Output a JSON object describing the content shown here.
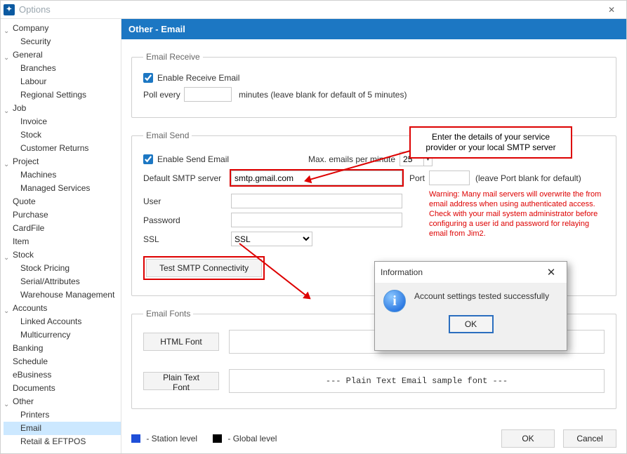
{
  "window": {
    "title": "Options"
  },
  "sidebar": {
    "items": [
      {
        "label": "Company",
        "expandable": true,
        "children": [
          {
            "label": "Security"
          }
        ]
      },
      {
        "label": "General",
        "expandable": true,
        "children": [
          {
            "label": "Branches"
          },
          {
            "label": "Labour"
          },
          {
            "label": "Regional Settings"
          }
        ]
      },
      {
        "label": "Job",
        "expandable": true,
        "children": [
          {
            "label": "Invoice"
          },
          {
            "label": "Stock"
          },
          {
            "label": "Customer Returns"
          }
        ]
      },
      {
        "label": "Project",
        "expandable": true,
        "children": [
          {
            "label": "Machines"
          },
          {
            "label": "Managed Services"
          }
        ]
      },
      {
        "label": "Quote",
        "expandable": false
      },
      {
        "label": "Purchase",
        "expandable": false
      },
      {
        "label": "CardFile",
        "expandable": false
      },
      {
        "label": "Item",
        "expandable": false
      },
      {
        "label": "Stock",
        "expandable": true,
        "children": [
          {
            "label": "Stock Pricing"
          },
          {
            "label": "Serial/Attributes"
          },
          {
            "label": "Warehouse Management"
          }
        ]
      },
      {
        "label": "Accounts",
        "expandable": true,
        "children": [
          {
            "label": "Linked Accounts"
          },
          {
            "label": "Multicurrency"
          }
        ]
      },
      {
        "label": "Banking",
        "expandable": false
      },
      {
        "label": "Schedule",
        "expandable": false
      },
      {
        "label": "eBusiness",
        "expandable": false
      },
      {
        "label": "Documents",
        "expandable": false
      },
      {
        "label": "Other",
        "expandable": true,
        "children": [
          {
            "label": "Printers"
          },
          {
            "label": "Email",
            "selected": true
          },
          {
            "label": "Retail & EFTPOS"
          }
        ]
      }
    ]
  },
  "main": {
    "header": "Other - Email",
    "receive": {
      "legend": "Email Receive",
      "enable_label": "Enable Receive Email",
      "enable_checked": true,
      "poll_label": "Poll every",
      "poll_value": "",
      "poll_suffix": "minutes (leave blank for default of 5 minutes)"
    },
    "send": {
      "legend": "Email Send",
      "enable_label": "Enable Send Email",
      "enable_checked": true,
      "max_label": "Max. emails per minute",
      "max_value": "25",
      "smtp_label": "Default SMTP server",
      "smtp_value": "smtp.gmail.com",
      "port_label": "Port",
      "port_value": "",
      "port_hint": "(leave Port blank for default)",
      "user_label": "User",
      "user_value": "",
      "password_label": "Password",
      "password_value": "",
      "ssl_label": "SSL",
      "ssl_value": "SSL",
      "warning": "Warning: Many mail servers will overwrite the from email address when using authenticated access. Check with your mail system administrator before configuring a user id and password for relaying email from Jim2.",
      "test_btn": "Test SMTP Connectivity"
    },
    "fonts": {
      "legend": "Email Fonts",
      "html_btn": "HTML Font",
      "plain_btn": "Plain Text Font",
      "plain_sample": "--- Plain Text Email sample font ---"
    },
    "legend_station": "- Station level",
    "legend_global": "- Global level",
    "ok": "OK",
    "cancel": "Cancel"
  },
  "callout": "Enter the details of your service provider or your local SMTP server",
  "dialog": {
    "title": "Information",
    "message": "Account settings tested successfully",
    "ok": "OK"
  }
}
